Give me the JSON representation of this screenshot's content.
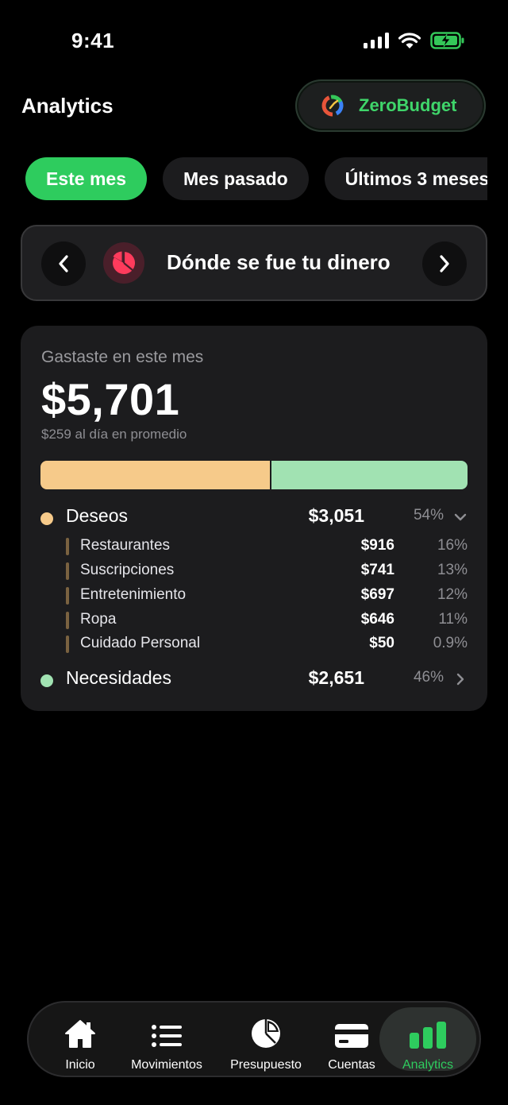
{
  "status": {
    "time": "9:41"
  },
  "header": {
    "title": "Analytics",
    "brand": "ZeroBudget"
  },
  "periods": [
    {
      "label": "Este mes",
      "active": true
    },
    {
      "label": "Mes pasado",
      "active": false
    },
    {
      "label": "Últimos 3 meses",
      "active": false
    }
  ],
  "section": {
    "title": "Dónde se fue tu dinero"
  },
  "summary": {
    "label": "Gastaste en este mes",
    "amount": "$5,701",
    "average": "$259 al día en promedio",
    "split": [
      0.54,
      0.46
    ]
  },
  "categories": [
    {
      "name": "Deseos",
      "amount": "$3,051",
      "pct": "54%",
      "color": "#f6ca8a",
      "expanded": true,
      "items": [
        {
          "name": "Restaurantes",
          "amount": "$916",
          "pct": "16%"
        },
        {
          "name": "Suscripciones",
          "amount": "$741",
          "pct": "13%"
        },
        {
          "name": "Entretenimiento",
          "amount": "$697",
          "pct": "12%"
        },
        {
          "name": "Ropa",
          "amount": "$646",
          "pct": "11%"
        },
        {
          "name": "Cuidado Personal",
          "amount": "$50",
          "pct": "0.9%"
        }
      ]
    },
    {
      "name": "Necesidades",
      "amount": "$2,651",
      "pct": "46%",
      "color": "#a1e2b2",
      "expanded": false
    }
  ],
  "tabbar": [
    {
      "label": "Inicio",
      "icon": "home-icon"
    },
    {
      "label": "Movimientos",
      "icon": "list-icon"
    },
    {
      "label": "Presupuesto",
      "icon": "pie-chart-icon"
    },
    {
      "label": "Cuentas",
      "icon": "card-icon"
    },
    {
      "label": "Analytics",
      "icon": "bar-chart-icon",
      "active": true
    }
  ],
  "colors": {
    "accent": "#2ecc5e",
    "wants": "#f6ca8a",
    "needs": "#a1e2b2",
    "badge": "#ff3b5c"
  }
}
